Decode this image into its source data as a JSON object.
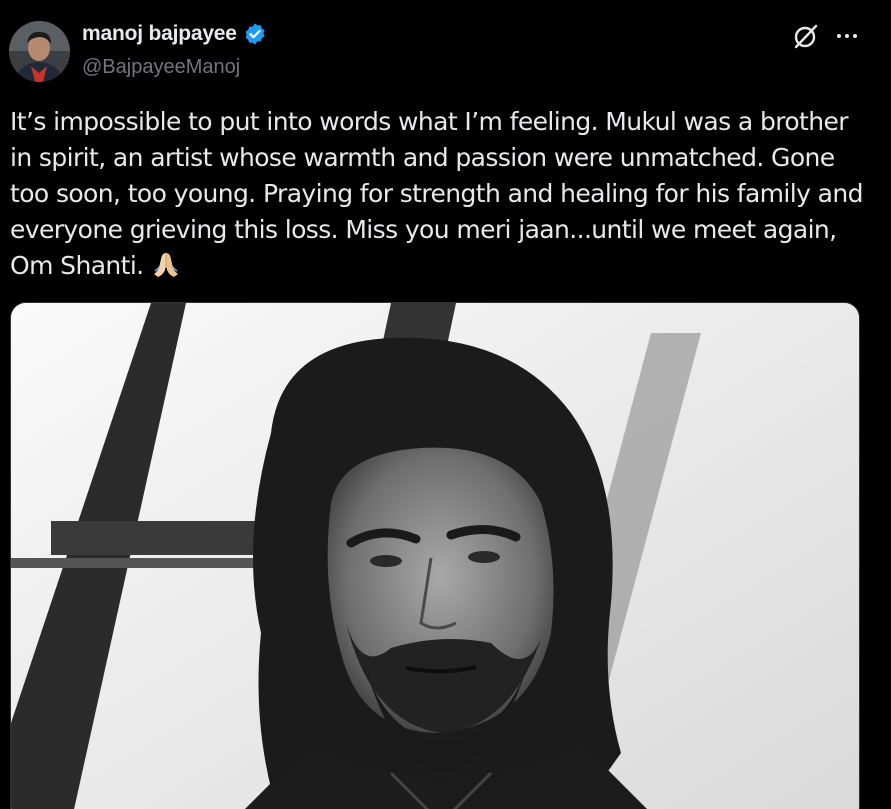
{
  "author": {
    "display_name": "manoj bajpayee",
    "handle": "@BajpayeeManoj",
    "verified": true,
    "verified_color": "#1d9bf0"
  },
  "tweet": {
    "text": "It’s impossible to put into words what I’m feeling. Mukul was a brother in spirit, an artist whose warmth and passion were unmatched. Gone too soon, too young. Praying for strength and healing for his family and everyone grieving this loss. Miss you meri jaan...until we meet again,  Om Shanti. ",
    "emoji": "folded-hands-emoji"
  },
  "actions": {
    "grok_icon": "grok-icon",
    "more_icon": "more-icon"
  },
  "media": {
    "type": "photo",
    "style": "black-and-white portrait"
  },
  "colors": {
    "background": "#000000",
    "text": "#e7e9ea",
    "secondary": "#71767b",
    "accent": "#1d9bf0"
  }
}
